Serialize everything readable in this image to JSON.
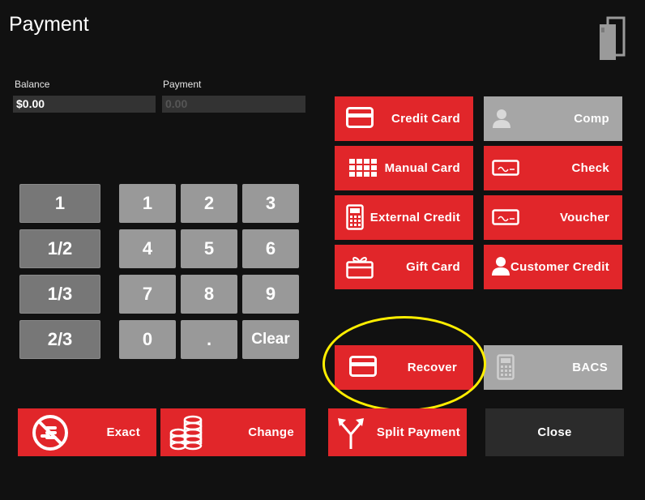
{
  "title": "Payment",
  "balance": {
    "label": "Balance",
    "value": "$0.00"
  },
  "payment": {
    "label": "Payment",
    "value": "0.00"
  },
  "fractions": [
    "1",
    "1/2",
    "1/3",
    "2/3"
  ],
  "keypad": [
    "1",
    "2",
    "3",
    "4",
    "5",
    "6",
    "7",
    "8",
    "9",
    "0",
    ".",
    "Clear"
  ],
  "methods": {
    "credit_card": "Credit Card",
    "comp": "Comp",
    "manual_card": "Manual Card",
    "check": "Check",
    "external_credit": "External Credit",
    "voucher": "Voucher",
    "gift_card": "Gift Card",
    "customer_credit": "Customer Credit",
    "recover": "Recover",
    "bacs": "BACS"
  },
  "actions": {
    "exact": "Exact",
    "change": "Change",
    "split_payment": "Split Payment",
    "close": "Close"
  },
  "colors": {
    "red": "#e1262a",
    "gray": "#a6a6a6",
    "highlight": "#ffee00"
  }
}
